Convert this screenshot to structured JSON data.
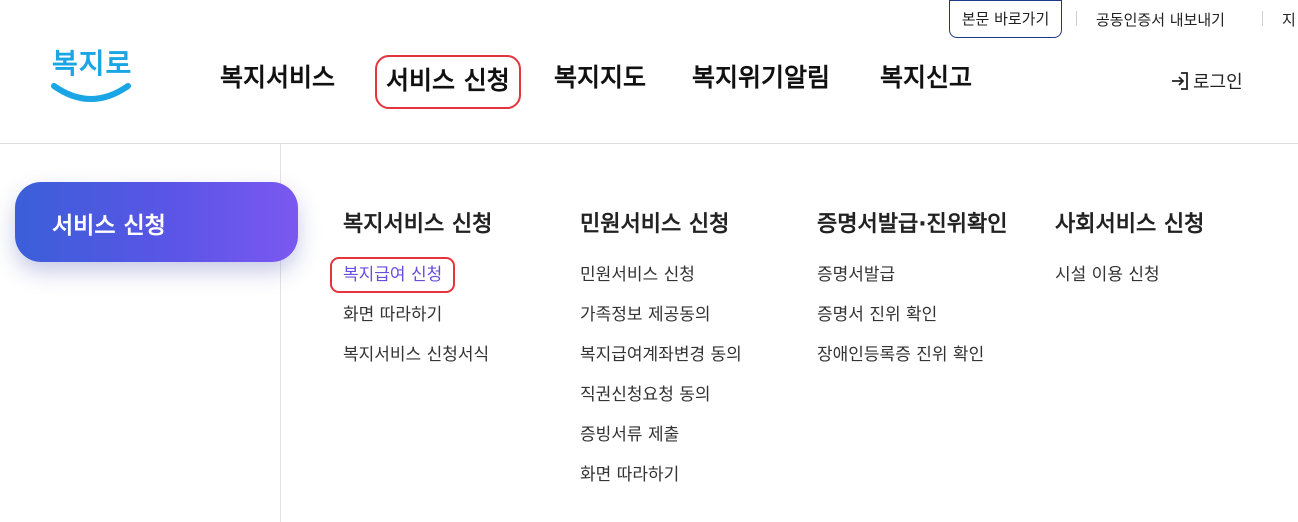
{
  "utility": {
    "skip_link": "본문 바로가기",
    "cert_export": "공동인증서 내보내기",
    "truncated": "지"
  },
  "logo": {
    "text": "복지로"
  },
  "gnb": {
    "items": [
      "복지서비스",
      "서비스 신청",
      "복지지도",
      "복지위기알림",
      "복지신고"
    ],
    "active_index": 1
  },
  "login": {
    "label": "로그인"
  },
  "side": {
    "title": "서비스 신청"
  },
  "menu": {
    "columns": [
      {
        "title": "복지서비스 신청",
        "items": [
          "복지급여 신청",
          "화면 따라하기",
          "복지서비스 신청서식"
        ]
      },
      {
        "title": "민원서비스 신청",
        "items": [
          "민원서비스 신청",
          "가족정보 제공동의",
          "복지급여계좌변경 동의",
          "직권신청요청 동의",
          "증빙서류 제출",
          "화면 따라하기"
        ]
      },
      {
        "title": "증명서발급·진위확인",
        "items": [
          "증명서발급",
          "증명서 진위 확인",
          "장애인등록증 진위 확인"
        ]
      },
      {
        "title": "사회서비스 신청",
        "items": [
          "시설 이용 신청"
        ]
      }
    ],
    "selected_item": "복지급여 신청"
  },
  "colors": {
    "highlight_border": "#e5343d",
    "selected_link": "#6a4de0",
    "side_gradient_start": "#3b5fd9",
    "side_gradient_end": "#7b58f0",
    "logo": "#1aa6e4"
  },
  "icons": {
    "login": "login-arrow-icon",
    "logo_smile": "smile-curve-icon"
  }
}
